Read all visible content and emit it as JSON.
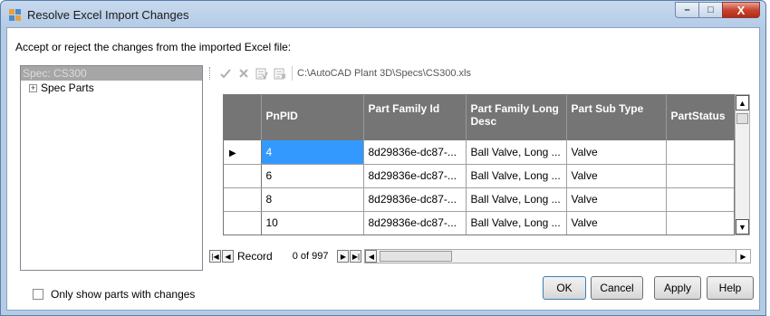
{
  "window": {
    "title": "Resolve Excel Import Changes",
    "caption_buttons": {
      "minimize": "–",
      "maximize": "□",
      "close": "X"
    }
  },
  "instructions": "Accept or reject the changes from the imported Excel file:",
  "tree": {
    "header": "Spec: CS300",
    "items": [
      {
        "expander": "+",
        "label": "Spec Parts"
      }
    ]
  },
  "toolbar": {
    "accept_icon": "checkmark-icon",
    "reject_icon": "x-icon",
    "accept_all_icon": "accept-all-icon",
    "reject_all_icon": "reject-all-icon",
    "path": "C:\\AutoCAD Plant 3D\\Specs\\CS300.xls"
  },
  "grid": {
    "columns": [
      {
        "label": "PnPID"
      },
      {
        "label": "Part Family Id"
      },
      {
        "label": "Part Family Long Desc"
      },
      {
        "label": "Part Sub Type"
      },
      {
        "label": "PartStatus"
      }
    ],
    "rows": [
      {
        "pointer": "▶",
        "cells": [
          "4",
          "8d29836e-dc87-...",
          "Ball Valve, Long ...",
          "Valve",
          ""
        ]
      },
      {
        "pointer": "",
        "cells": [
          "6",
          "8d29836e-dc87-...",
          "Ball Valve, Long ...",
          "Valve",
          ""
        ]
      },
      {
        "pointer": "",
        "cells": [
          "8",
          "8d29836e-dc87-...",
          "Ball Valve, Long ...",
          "Valve",
          ""
        ]
      },
      {
        "pointer": "",
        "cells": [
          "10",
          "8d29836e-dc87-...",
          "Ball Valve, Long ...",
          "Valve",
          ""
        ]
      }
    ]
  },
  "navigator": {
    "label": "Record",
    "count": "0 of 997"
  },
  "only_changes_label": "Only show parts with changes",
  "buttons": {
    "ok": "OK",
    "cancel": "Cancel",
    "apply": "Apply",
    "help": "Help"
  },
  "colors": {
    "header_bg": "#757575",
    "selected_cell": "#3399ff",
    "title_bar": "#b4cbe6"
  }
}
